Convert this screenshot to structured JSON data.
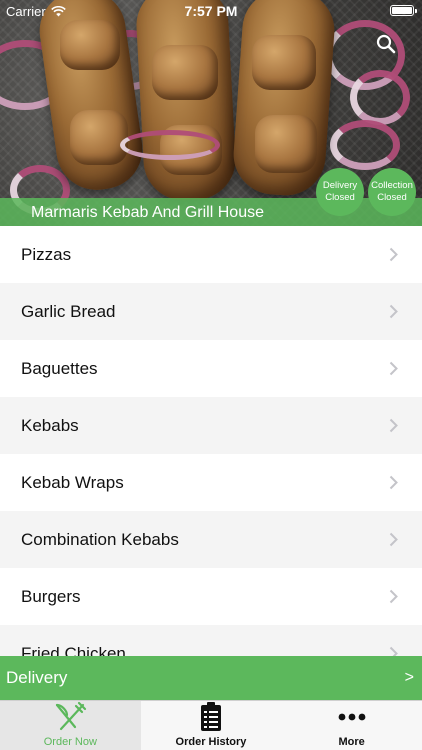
{
  "status_bar": {
    "carrier": "Carrier",
    "time": "7:57 PM"
  },
  "header": {
    "restaurant_name": "Marmaris Kebab And Grill House",
    "delivery_badge": {
      "line1": "Delivery",
      "line2": "Closed"
    },
    "collection_badge": {
      "line1": "Collection",
      "line2": "Closed"
    },
    "search_icon": "search-icon"
  },
  "menu": {
    "items": [
      {
        "label": "Pizzas"
      },
      {
        "label": "Garlic Bread"
      },
      {
        "label": "Baguettes"
      },
      {
        "label": "Kebabs"
      },
      {
        "label": "Kebab Wraps"
      },
      {
        "label": "Combination Kebabs"
      },
      {
        "label": "Burgers"
      },
      {
        "label": "Fried Chicken"
      }
    ]
  },
  "delivery_bar": {
    "label": "Delivery",
    "arrow": ">"
  },
  "tab_bar": {
    "tabs": [
      {
        "label": "Order Now",
        "icon": "fork-knife-icon",
        "active": true
      },
      {
        "label": "Order History",
        "icon": "clipboard-icon",
        "active": false
      },
      {
        "label": "More",
        "icon": "more-dots-icon",
        "active": false
      }
    ]
  },
  "colors": {
    "accent": "#5cb85c",
    "onion": "#b04d78",
    "text": "#111111",
    "tab_bg": "#f7f7f7"
  }
}
